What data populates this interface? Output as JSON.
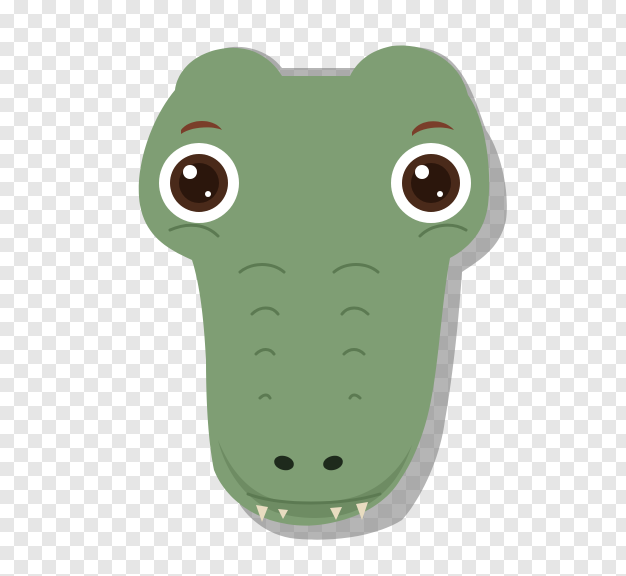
{
  "image": {
    "subject": "crocodile-head-illustration",
    "background": "transparency-checkerboard"
  },
  "colors": {
    "skin": "#7f9e74",
    "skin_dark": "#6e8c63",
    "shadow": "rgba(120,120,120,0.55)",
    "eye_white": "#ffffff",
    "iris": "#4a2a1a",
    "pupil": "#2b160c",
    "brow": "#7a3e2a",
    "nostril": "#1e2a1c",
    "tooth": "#e8dcc0",
    "checker_light": "#ffffff",
    "checker_dark": "#e6e6e6"
  }
}
